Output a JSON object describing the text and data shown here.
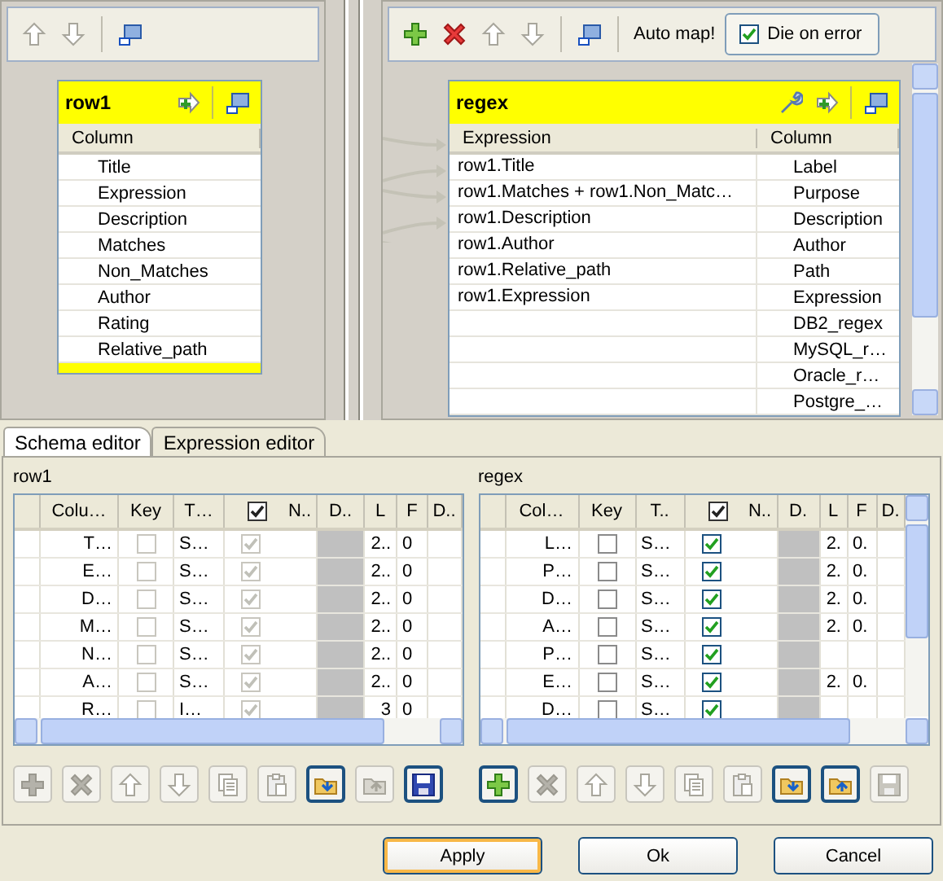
{
  "input_panel": {
    "toolbar": [
      {
        "kind": "up",
        "enabled": false
      },
      {
        "kind": "down",
        "enabled": false
      },
      {
        "kind": "sep"
      },
      {
        "kind": "minimize",
        "enabled": true
      }
    ],
    "table": {
      "name": "row1",
      "tools": [
        {
          "kind": "add-output"
        },
        {
          "kind": "sep"
        },
        {
          "kind": "minimize"
        }
      ],
      "header": "Column",
      "rows": [
        "Title",
        "Expression",
        "Description",
        "Matches",
        "Non_Matches",
        "Author",
        "Rating",
        "Relative_path"
      ]
    }
  },
  "output_panel": {
    "toolbar": [
      {
        "kind": "add",
        "enabled": true
      },
      {
        "kind": "delete",
        "enabled": true
      },
      {
        "kind": "up",
        "enabled": false
      },
      {
        "kind": "down",
        "enabled": false
      },
      {
        "kind": "sep"
      },
      {
        "kind": "minimize",
        "enabled": true
      },
      {
        "kind": "sep"
      }
    ],
    "auto_map": "Auto map!",
    "die_on_error": {
      "label": "Die on error",
      "checked": true
    },
    "table": {
      "name": "regex",
      "tools": [
        {
          "kind": "wrench"
        },
        {
          "kind": "add-output"
        },
        {
          "kind": "sep"
        },
        {
          "kind": "minimize"
        }
      ],
      "columns": [
        "Expression",
        "Column"
      ],
      "rows": [
        {
          "expression": "row1.Title",
          "column": "Label"
        },
        {
          "expression": "row1.Matches  + row1.Non_Matc…",
          "column": "Purpose"
        },
        {
          "expression": "row1.Description",
          "column": "Description"
        },
        {
          "expression": "row1.Author",
          "column": "Author"
        },
        {
          "expression": "row1.Relative_path",
          "column": "Path"
        },
        {
          "expression": "row1.Expression",
          "column": "Expression"
        },
        {
          "column": "DB2_regex"
        },
        {
          "column": "MySQL_r…"
        },
        {
          "column": "Oracle_r…"
        },
        {
          "column": "Postgre_…"
        }
      ]
    }
  },
  "tabs": [
    {
      "label": "Schema editor",
      "selected": true
    },
    {
      "label": "Expression editor",
      "selected": false
    }
  ],
  "schema_editors": [
    {
      "title": "row1",
      "editable": false,
      "columns": [
        "Colu…",
        "Key",
        "T…",
        "N..",
        "D..",
        "L",
        "F",
        "D.."
      ],
      "nullable_header_checked": true,
      "rows": [
        {
          "column": "T…",
          "key": false,
          "type": "S…",
          "nullable": true,
          "length": "2..",
          "precision": "0"
        },
        {
          "column": "E…",
          "key": false,
          "type": "S…",
          "nullable": true,
          "length": "2..",
          "precision": "0"
        },
        {
          "column": "D…",
          "key": false,
          "type": "S…",
          "nullable": true,
          "length": "2..",
          "precision": "0"
        },
        {
          "column": "M…",
          "key": false,
          "type": "S…",
          "nullable": true,
          "length": "2..",
          "precision": "0"
        },
        {
          "column": "N…",
          "key": false,
          "type": "S…",
          "nullable": true,
          "length": "2..",
          "precision": "0"
        },
        {
          "column": "A…",
          "key": false,
          "type": "S…",
          "nullable": true,
          "length": "2..",
          "precision": "0"
        },
        {
          "column": "R…",
          "key": false,
          "type": "I…",
          "nullable": true,
          "length": "3",
          "precision": "0"
        }
      ],
      "toolbar": [
        {
          "kind": "add",
          "enabled": false
        },
        {
          "kind": "delete",
          "enabled": false
        },
        {
          "kind": "up",
          "enabled": false
        },
        {
          "kind": "down",
          "enabled": false
        },
        {
          "kind": "copy",
          "enabled": false
        },
        {
          "kind": "paste",
          "enabled": false
        },
        {
          "kind": "import",
          "enabled": true
        },
        {
          "kind": "export",
          "enabled": false
        },
        {
          "kind": "save",
          "enabled": true
        }
      ]
    },
    {
      "title": "regex",
      "editable": true,
      "columns": [
        "Col…",
        "Key",
        "T..",
        "N..",
        "D.",
        "L",
        "F",
        "D."
      ],
      "nullable_header_checked": true,
      "rows": [
        {
          "column": "L…",
          "key": false,
          "type": "S…",
          "nullable": true,
          "length": "2.",
          "precision": "0."
        },
        {
          "column": "P…",
          "key": false,
          "type": "S…",
          "nullable": true,
          "length": "2.",
          "precision": "0."
        },
        {
          "column": "D…",
          "key": false,
          "type": "S…",
          "nullable": true,
          "length": "2.",
          "precision": "0."
        },
        {
          "column": "A…",
          "key": false,
          "type": "S…",
          "nullable": true,
          "length": "2.",
          "precision": "0."
        },
        {
          "column": "P…",
          "key": false,
          "type": "S…",
          "nullable": true
        },
        {
          "column": "E…",
          "key": false,
          "type": "S…",
          "nullable": true,
          "length": "2.",
          "precision": "0."
        },
        {
          "column": "D…",
          "key": false,
          "type": "S…",
          "nullable": true
        }
      ],
      "toolbar": [
        {
          "kind": "add",
          "enabled": true
        },
        {
          "kind": "delete",
          "enabled": false
        },
        {
          "kind": "up",
          "enabled": false
        },
        {
          "kind": "down",
          "enabled": false
        },
        {
          "kind": "copy",
          "enabled": false
        },
        {
          "kind": "paste",
          "enabled": false
        },
        {
          "kind": "import",
          "enabled": true
        },
        {
          "kind": "export",
          "enabled": true
        },
        {
          "kind": "save",
          "enabled": false
        }
      ]
    }
  ],
  "buttons": [
    {
      "label": "Apply",
      "selected": true
    },
    {
      "label": "Ok",
      "selected": false
    },
    {
      "label": "Cancel",
      "selected": false
    }
  ]
}
